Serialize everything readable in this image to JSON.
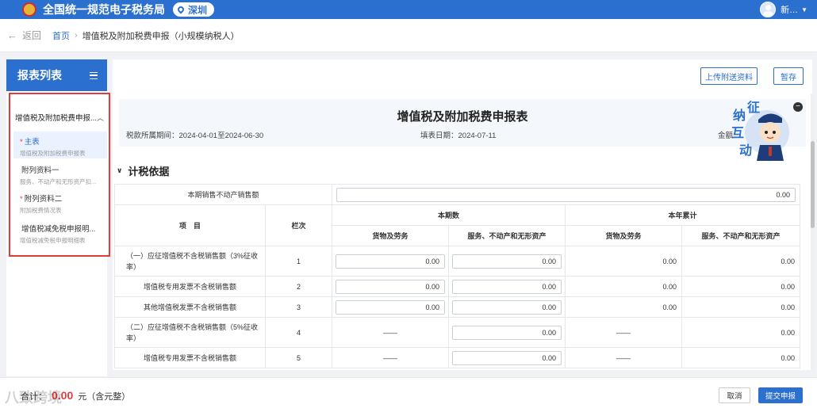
{
  "topbar": {
    "app_title": "全国统一规范电子税务局",
    "city": "深圳",
    "user_name": "新…"
  },
  "breadcrumb": {
    "back_label": "返回",
    "home": "首页",
    "current": "增值税及附加税费申报（小规模纳税人）"
  },
  "sidebar": {
    "title": "报表列表",
    "group_label": "增值税及附加税费申报...",
    "items": [
      {
        "label": "主表",
        "sub": "增值税及附加税费申报表",
        "required": "*"
      },
      {
        "label": "附列资料一",
        "sub": "服务、不动产和无形资产扣...",
        "required": ""
      },
      {
        "label": "附列资料二",
        "sub": "附加税费情况表",
        "required": "*"
      },
      {
        "label": "增值税减免税申报明...",
        "sub": "增值税减免税申报明细表",
        "required": ""
      }
    ]
  },
  "toolbar": {
    "upload_label": "上传附送资料",
    "save_label": "暂存"
  },
  "form": {
    "title": "增值税及附加税费申报表",
    "period": "税款所属期间：2024-04-01至2024-06-30",
    "fill_date": "填表日期：2024-07-11",
    "amount_unit": "金额",
    "mascot_text": "征纳互动",
    "section_title": "计税依据"
  },
  "table": {
    "top_row_label": "本期销售不动产销售额",
    "top_row_value": "0.00",
    "col_item": "项　目",
    "col_line": "栏次",
    "col_current": "本期数",
    "col_ytd": "本年累计",
    "col_goods": "货物及劳务",
    "col_service": "服务、不动产和无形资产",
    "col_goods2": "货物及劳务",
    "col_service2": "服务、不动产和无形资产",
    "rows": [
      {
        "item": "（一）应征增值税不含税销售额（3%征收率）",
        "line": "1",
        "goods": "0.00",
        "service": "0.00",
        "ytd_goods": "0.00",
        "ytd_service": "0.00"
      },
      {
        "item": "增值税专用发票不含税销售额",
        "line": "2",
        "goods": "0.00",
        "service": "0.00",
        "ytd_goods": "0.00",
        "ytd_service": "0.00"
      },
      {
        "item": "其他增值税发票不含税销售额",
        "line": "3",
        "goods": "0.00",
        "service": "0.00",
        "ytd_goods": "0.00",
        "ytd_service": "0.00"
      },
      {
        "item": "（二）应征增值税不含税销售额（5%征收率）",
        "line": "4",
        "goods": "——",
        "service": "0.00",
        "ytd_goods": "——",
        "ytd_service": "0.00"
      },
      {
        "item": "增值税专用发票不含税销售额",
        "line": "5",
        "goods": "——",
        "service": "0.00",
        "ytd_goods": "——",
        "ytd_service": "0.00"
      }
    ]
  },
  "footer": {
    "total_prefix": "合计：",
    "total_amount": "0.00",
    "total_suffix": "元（含元整）",
    "watermark": "八致跨境",
    "cancel_label": "取消",
    "submit_label": "提交申报"
  }
}
